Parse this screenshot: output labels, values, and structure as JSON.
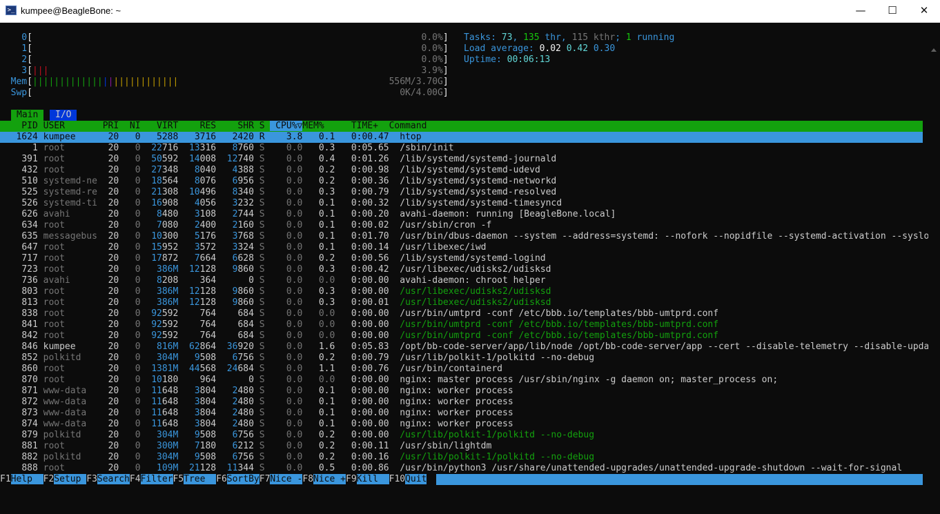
{
  "window": {
    "title": "kumpee@BeagleBone: ~",
    "icon": "terminal-icon",
    "minimize": "—",
    "maximize": "☐",
    "close": "✕"
  },
  "meters": [
    {
      "label": "0",
      "value": "0.0%",
      "bars": 0
    },
    {
      "label": "1",
      "value": "0.0%",
      "bars": 0
    },
    {
      "label": "2",
      "value": "0.0%",
      "bars": 0
    },
    {
      "label": "3",
      "value": "3.9%",
      "bars": 3
    },
    {
      "label": "Mem",
      "value": "556M/3.70G",
      "bars": 27
    },
    {
      "label": "Swp",
      "value": "0K/4.00G",
      "bars": 0
    }
  ],
  "summary": {
    "tasks_label": "Tasks: ",
    "tasks": "73",
    "thr_sep": ", ",
    "thr": "135",
    "thr_label": " thr",
    "kthr_sep": ", ",
    "kthr": "115 kthr",
    "run_sep": "; ",
    "running": "1",
    "running_label": " running",
    "load_label": "Load average: ",
    "load1": "0.02",
    "load5": "0.42",
    "load15": "0.30",
    "uptime_label": "Uptime: ",
    "uptime": "00:06:13"
  },
  "tabs": [
    {
      "label": "Main",
      "active": true
    },
    {
      "label": "I/O",
      "active": false
    }
  ],
  "columns": {
    "pid": "PID",
    "user": "USER",
    "pri": "PRI",
    "ni": "NI",
    "virt": "VIRT",
    "res": "RES",
    "shr": "SHR",
    "s": "S",
    "cpu": "CPU%",
    "sort_marker": "▽",
    "mem": "MEM%",
    "time": "TIME+",
    "command": "Command"
  },
  "processes": [
    {
      "pid": "1624",
      "user": "kumpee",
      "pri": "20",
      "ni": "0",
      "virt": "5288",
      "res": "3716",
      "shr": "2420",
      "s": "R",
      "cpu": "3.8",
      "mem": "0.1",
      "time": "0:00.47",
      "cmd": "htop",
      "selected": true
    },
    {
      "pid": "1",
      "user": "root",
      "pri": "20",
      "ni": "0",
      "virt": "22716",
      "res": "13316",
      "shr": "8760",
      "s": "S",
      "cpu": "0.0",
      "mem": "0.3",
      "time": "0:05.65",
      "cmd": "/sbin/init"
    },
    {
      "pid": "391",
      "user": "root",
      "pri": "20",
      "ni": "0",
      "virt": "50592",
      "res": "14008",
      "shr": "12740",
      "s": "S",
      "cpu": "0.0",
      "mem": "0.4",
      "time": "0:01.26",
      "cmd": "/lib/systemd/systemd-journald"
    },
    {
      "pid": "432",
      "user": "root",
      "pri": "20",
      "ni": "0",
      "virt": "27348",
      "res": "8040",
      "shr": "4388",
      "s": "S",
      "cpu": "0.0",
      "mem": "0.2",
      "time": "0:00.98",
      "cmd": "/lib/systemd/systemd-udevd"
    },
    {
      "pid": "510",
      "user": "systemd-ne",
      "pri": "20",
      "ni": "0",
      "virt": "18564",
      "res": "8076",
      "shr": "6956",
      "s": "S",
      "cpu": "0.0",
      "mem": "0.2",
      "time": "0:00.36",
      "cmd": "/lib/systemd/systemd-networkd"
    },
    {
      "pid": "525",
      "user": "systemd-re",
      "pri": "20",
      "ni": "0",
      "virt": "21308",
      "res": "10496",
      "shr": "8340",
      "s": "S",
      "cpu": "0.0",
      "mem": "0.3",
      "time": "0:00.79",
      "cmd": "/lib/systemd/systemd-resolved"
    },
    {
      "pid": "526",
      "user": "systemd-ti",
      "pri": "20",
      "ni": "0",
      "virt": "16908",
      "res": "4056",
      "shr": "3232",
      "s": "S",
      "cpu": "0.0",
      "mem": "0.1",
      "time": "0:00.32",
      "cmd": "/lib/systemd/systemd-timesyncd"
    },
    {
      "pid": "626",
      "user": "avahi",
      "pri": "20",
      "ni": "0",
      "virt": "8480",
      "res": "3108",
      "shr": "2744",
      "s": "S",
      "cpu": "0.0",
      "mem": "0.1",
      "time": "0:00.20",
      "cmd": "avahi-daemon: running [BeagleBone.local]"
    },
    {
      "pid": "634",
      "user": "root",
      "pri": "20",
      "ni": "0",
      "virt": "7080",
      "res": "2400",
      "shr": "2160",
      "s": "S",
      "cpu": "0.0",
      "mem": "0.1",
      "time": "0:00.02",
      "cmd": "/usr/sbin/cron -f"
    },
    {
      "pid": "635",
      "user": "messagebus",
      "pri": "20",
      "ni": "0",
      "virt": "10300",
      "res": "5176",
      "shr": "3768",
      "s": "S",
      "cpu": "0.0",
      "mem": "0.1",
      "time": "0:01.70",
      "cmd": "/usr/bin/dbus-daemon --system --address=systemd: --nofork --nopidfile --systemd-activation --syslog-"
    },
    {
      "pid": "647",
      "user": "root",
      "pri": "20",
      "ni": "0",
      "virt": "15952",
      "res": "3572",
      "shr": "3324",
      "s": "S",
      "cpu": "0.0",
      "mem": "0.1",
      "time": "0:00.14",
      "cmd": "/usr/libexec/iwd"
    },
    {
      "pid": "717",
      "user": "root",
      "pri": "20",
      "ni": "0",
      "virt": "17872",
      "res": "7664",
      "shr": "6628",
      "s": "S",
      "cpu": "0.0",
      "mem": "0.2",
      "time": "0:00.56",
      "cmd": "/lib/systemd/systemd-logind"
    },
    {
      "pid": "723",
      "user": "root",
      "pri": "20",
      "ni": "0",
      "virt": "386M",
      "res": "12128",
      "shr": "9860",
      "s": "S",
      "cpu": "0.0",
      "mem": "0.3",
      "time": "0:00.42",
      "cmd": "/usr/libexec/udisks2/udisksd"
    },
    {
      "pid": "736",
      "user": "avahi",
      "pri": "20",
      "ni": "0",
      "virt": "8208",
      "res": "364",
      "shr": "0",
      "s": "S",
      "cpu": "0.0",
      "mem": "0.0",
      "time": "0:00.00",
      "cmd": "avahi-daemon: chroot helper"
    },
    {
      "pid": "803",
      "user": "root",
      "pri": "20",
      "ni": "0",
      "virt": "386M",
      "res": "12128",
      "shr": "9860",
      "s": "S",
      "cpu": "0.0",
      "mem": "0.3",
      "time": "0:00.00",
      "cmd": "/usr/libexec/udisks2/udisksd",
      "thread": true
    },
    {
      "pid": "813",
      "user": "root",
      "pri": "20",
      "ni": "0",
      "virt": "386M",
      "res": "12128",
      "shr": "9860",
      "s": "S",
      "cpu": "0.0",
      "mem": "0.3",
      "time": "0:00.01",
      "cmd": "/usr/libexec/udisks2/udisksd",
      "thread": true
    },
    {
      "pid": "838",
      "user": "root",
      "pri": "20",
      "ni": "0",
      "virt": "92592",
      "res": "764",
      "shr": "684",
      "s": "S",
      "cpu": "0.0",
      "mem": "0.0",
      "time": "0:00.00",
      "cmd": "/usr/bin/umtprd -conf /etc/bbb.io/templates/bbb-umtprd.conf"
    },
    {
      "pid": "841",
      "user": "root",
      "pri": "20",
      "ni": "0",
      "virt": "92592",
      "res": "764",
      "shr": "684",
      "s": "S",
      "cpu": "0.0",
      "mem": "0.0",
      "time": "0:00.00",
      "cmd": "/usr/bin/umtprd -conf /etc/bbb.io/templates/bbb-umtprd.conf",
      "thread": true
    },
    {
      "pid": "842",
      "user": "root",
      "pri": "20",
      "ni": "0",
      "virt": "92592",
      "res": "764",
      "shr": "684",
      "s": "S",
      "cpu": "0.0",
      "mem": "0.0",
      "time": "0:00.00",
      "cmd": "/usr/bin/umtprd -conf /etc/bbb.io/templates/bbb-umtprd.conf",
      "thread": true
    },
    {
      "pid": "846",
      "user": "kumpee",
      "pri": "20",
      "ni": "0",
      "virt": "816M",
      "res": "62864",
      "shr": "36920",
      "s": "S",
      "cpu": "0.0",
      "mem": "1.6",
      "time": "0:05.83",
      "cmd": "/opt/bb-code-server/app/lib/node /opt/bb-code-server/app --cert --disable-telemetry --disable-update"
    },
    {
      "pid": "852",
      "user": "polkitd",
      "pri": "20",
      "ni": "0",
      "virt": "304M",
      "res": "9508",
      "shr": "6756",
      "s": "S",
      "cpu": "0.0",
      "mem": "0.2",
      "time": "0:00.79",
      "cmd": "/usr/lib/polkit-1/polkitd --no-debug"
    },
    {
      "pid": "860",
      "user": "root",
      "pri": "20",
      "ni": "0",
      "virt": "1381M",
      "res": "44568",
      "shr": "24684",
      "s": "S",
      "cpu": "0.0",
      "mem": "1.1",
      "time": "0:00.76",
      "cmd": "/usr/bin/containerd"
    },
    {
      "pid": "870",
      "user": "root",
      "pri": "20",
      "ni": "0",
      "virt": "10180",
      "res": "964",
      "shr": "0",
      "s": "S",
      "cpu": "0.0",
      "mem": "0.0",
      "time": "0:00.00",
      "cmd": "nginx: master process /usr/sbin/nginx -g daemon on; master_process on;"
    },
    {
      "pid": "871",
      "user": "www-data",
      "pri": "20",
      "ni": "0",
      "virt": "11648",
      "res": "3804",
      "shr": "2480",
      "s": "S",
      "cpu": "0.0",
      "mem": "0.1",
      "time": "0:00.00",
      "cmd": "nginx: worker process"
    },
    {
      "pid": "872",
      "user": "www-data",
      "pri": "20",
      "ni": "0",
      "virt": "11648",
      "res": "3804",
      "shr": "2480",
      "s": "S",
      "cpu": "0.0",
      "mem": "0.1",
      "time": "0:00.00",
      "cmd": "nginx: worker process"
    },
    {
      "pid": "873",
      "user": "www-data",
      "pri": "20",
      "ni": "0",
      "virt": "11648",
      "res": "3804",
      "shr": "2480",
      "s": "S",
      "cpu": "0.0",
      "mem": "0.1",
      "time": "0:00.00",
      "cmd": "nginx: worker process"
    },
    {
      "pid": "874",
      "user": "www-data",
      "pri": "20",
      "ni": "0",
      "virt": "11648",
      "res": "3804",
      "shr": "2480",
      "s": "S",
      "cpu": "0.0",
      "mem": "0.1",
      "time": "0:00.00",
      "cmd": "nginx: worker process"
    },
    {
      "pid": "879",
      "user": "polkitd",
      "pri": "20",
      "ni": "0",
      "virt": "304M",
      "res": "9508",
      "shr": "6756",
      "s": "S",
      "cpu": "0.0",
      "mem": "0.2",
      "time": "0:00.00",
      "cmd": "/usr/lib/polkit-1/polkitd --no-debug",
      "thread": true
    },
    {
      "pid": "881",
      "user": "root",
      "pri": "20",
      "ni": "0",
      "virt": "300M",
      "res": "7180",
      "shr": "6212",
      "s": "S",
      "cpu": "0.0",
      "mem": "0.2",
      "time": "0:00.11",
      "cmd": "/usr/sbin/lightdm"
    },
    {
      "pid": "882",
      "user": "polkitd",
      "pri": "20",
      "ni": "0",
      "virt": "304M",
      "res": "9508",
      "shr": "6756",
      "s": "S",
      "cpu": "0.0",
      "mem": "0.2",
      "time": "0:00.16",
      "cmd": "/usr/lib/polkit-1/polkitd --no-debug",
      "thread": true
    },
    {
      "pid": "888",
      "user": "root",
      "pri": "20",
      "ni": "0",
      "virt": "109M",
      "res": "21128",
      "shr": "11344",
      "s": "S",
      "cpu": "0.0",
      "mem": "0.5",
      "time": "0:00.86",
      "cmd": "/usr/bin/python3 /usr/share/unattended-upgrades/unattended-upgrade-shutdown --wait-for-signal"
    }
  ],
  "fkeys": [
    {
      "key": "F1",
      "label": "Help  "
    },
    {
      "key": "F2",
      "label": "Setup "
    },
    {
      "key": "F3",
      "label": "Search"
    },
    {
      "key": "F4",
      "label": "Filter"
    },
    {
      "key": "F5",
      "label": "Tree  "
    },
    {
      "key": "F6",
      "label": "SortBy"
    },
    {
      "key": "F7",
      "label": "Nice -"
    },
    {
      "key": "F8",
      "label": "Nice +"
    },
    {
      "key": "F9",
      "label": "Kill  "
    },
    {
      "key": "F10",
      "label": "Quit"
    }
  ],
  "colors": {
    "green": "#13a10e",
    "blue": "#3a96dd",
    "cyan": "#61d6d6",
    "red": "#c50f1f",
    "background": "#0c0c0c"
  }
}
